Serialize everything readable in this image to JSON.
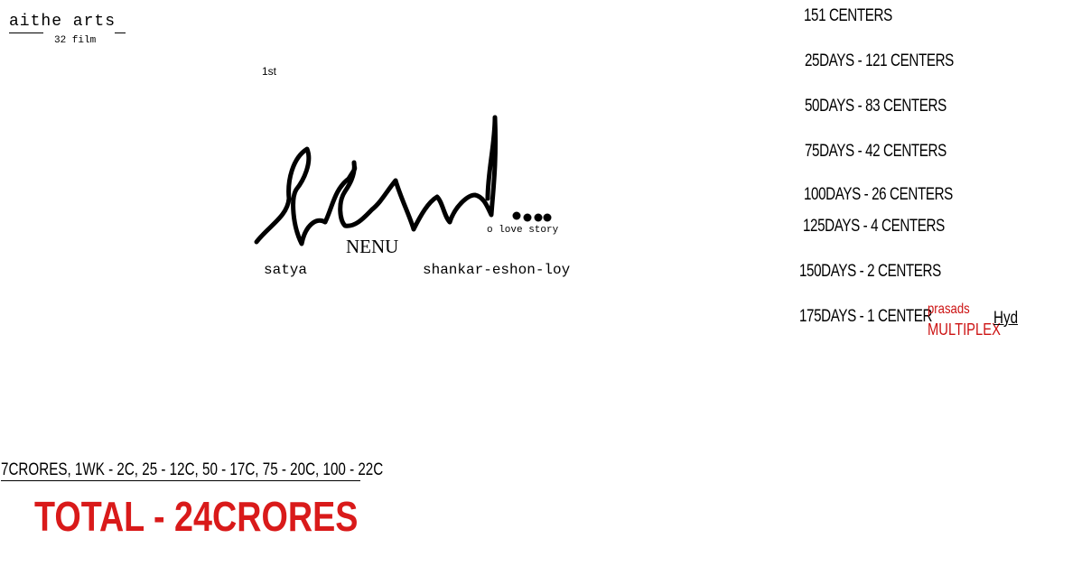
{
  "studio": {
    "name": "aithe arts",
    "film_number": "32 film"
  },
  "rank_label": "1st",
  "title_art": {
    "tag": "NENU",
    "tagline": "o love story"
  },
  "credits": {
    "star": "satya",
    "crew": "shankar-eshon-loy"
  },
  "centers": [
    "151 CENTERS",
    "25DAYS - 121 CENTERS",
    "50DAYS - 83 CENTERS",
    "75DAYS - 42 CENTERS",
    "100DAYS - 26 CENTERS",
    "125DAYS - 4 CENTERS",
    "150DAYS - 2 CENTERS",
    "175DAYS - 1 CENTER"
  ],
  "venue": {
    "name": "prasads",
    "type": "MULTIPLEX",
    "city": "Hyd"
  },
  "collections": "7CRORES,   1WK - 2C, 25 - 12C, 50 - 17C, 75 - 20C, 100 - 22C",
  "total": "TOTAL - 24CRORES",
  "colors": {
    "accent_red": "#d91a1a",
    "ink": "#000000",
    "background": "#ffffff"
  }
}
